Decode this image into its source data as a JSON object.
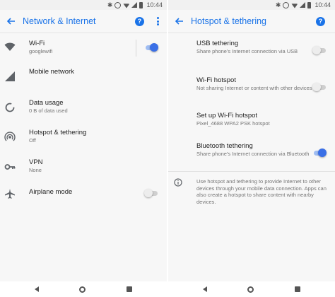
{
  "status_bar": {
    "time": "10:44"
  },
  "left": {
    "title": "Network & Internet",
    "help_glyph": "?",
    "items": [
      {
        "title": "Wi-Fi",
        "subtitle": "googlewifi",
        "icon": "wifi-icon",
        "toggle": "on"
      },
      {
        "title": "Mobile network",
        "subtitle": "",
        "icon": "mobile-signal-icon"
      },
      {
        "title": "Data usage",
        "subtitle": "0 B of data used",
        "icon": "data-usage-icon"
      },
      {
        "title": "Hotspot & tethering",
        "subtitle": "Off",
        "icon": "hotspot-icon"
      },
      {
        "title": "VPN",
        "subtitle": "None",
        "icon": "vpn-key-icon"
      },
      {
        "title": "Airplane mode",
        "subtitle": "",
        "icon": "airplane-icon",
        "toggle": "off"
      }
    ]
  },
  "right": {
    "title": "Hotspot & tethering",
    "help_glyph": "?",
    "items": [
      {
        "title": "USB tethering",
        "subtitle": "Share phone's Internet connection via USB",
        "toggle": "off"
      },
      {
        "title": "Wi-Fi hotspot",
        "subtitle": "Not sharing Internet or content with other devices",
        "toggle": "off"
      },
      {
        "title": "Set up Wi-Fi hotspot",
        "subtitle": "Pixel_4688 WPA2 PSK hotspot"
      },
      {
        "title": "Bluetooth tethering",
        "subtitle": "Share phone's Internet connection via Bluetooth",
        "toggle": "on"
      }
    ],
    "info": "Use hotspot and tethering to provide Internet to other devices through your mobile data connection. Apps can also create a hotspot to share content with nearby devices."
  },
  "colors": {
    "accent": "#1a73e8",
    "toggle_on": "#3a6fe6",
    "secondary_text": "#757575"
  }
}
